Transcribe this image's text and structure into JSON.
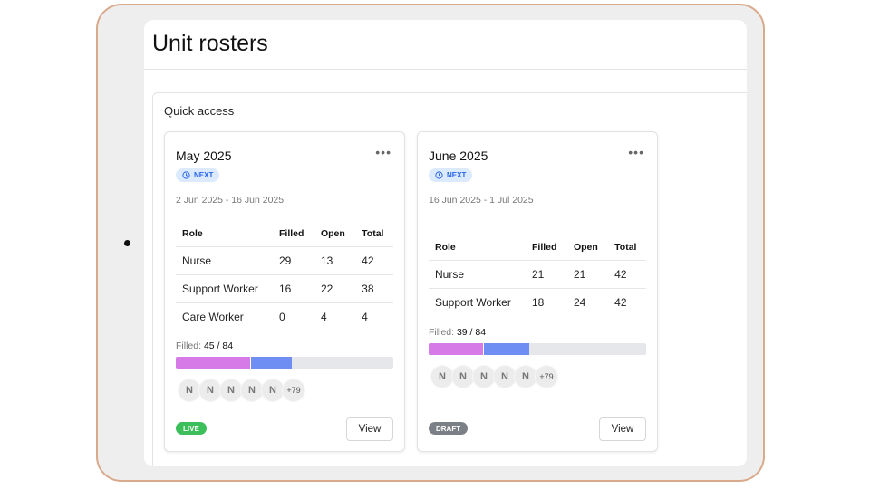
{
  "page": {
    "title": "Unit rosters"
  },
  "quick_access": {
    "title": "Quick access",
    "cards": [
      {
        "title": "May 2025",
        "badge": "NEXT",
        "dates": "2 Jun 2025 - 16 Jun 2025",
        "headers": [
          "Role",
          "Filled",
          "Open",
          "Total"
        ],
        "rows": [
          [
            "Nurse",
            "29",
            "13",
            "42"
          ],
          [
            "Support Worker",
            "16",
            "22",
            "38"
          ],
          [
            "Care Worker",
            "0",
            "4",
            "4"
          ]
        ],
        "filled_label": "Filled:",
        "filled_value": "45 / 84",
        "progress": {
          "segment_a": 0.34,
          "segment_b": 0.19
        },
        "avatars": [
          "N",
          "N",
          "N",
          "N",
          "N"
        ],
        "avatar_more": "+79",
        "status": "LIVE",
        "view_label": "View"
      },
      {
        "title": "June 2025",
        "badge": "NEXT",
        "dates": "16 Jun 2025 - 1 Jul 2025",
        "headers": [
          "Role",
          "Filled",
          "Open",
          "Total"
        ],
        "rows": [
          [
            "Nurse",
            "21",
            "21",
            "42"
          ],
          [
            "Support Worker",
            "18",
            "24",
            "42"
          ]
        ],
        "filled_label": "Filled:",
        "filled_value": "39 / 84",
        "progress": {
          "segment_a": 0.25,
          "segment_b": 0.21
        },
        "avatars": [
          "N",
          "N",
          "N",
          "N",
          "N"
        ],
        "avatar_more": "+79",
        "status": "DRAFT",
        "view_label": "View"
      }
    ]
  },
  "colors": {
    "progress_a": "#d57ae6",
    "progress_b": "#6e8ef4",
    "live": "#3cbf5b",
    "draft": "#7b7f86",
    "next_badge": "#2563eb"
  }
}
